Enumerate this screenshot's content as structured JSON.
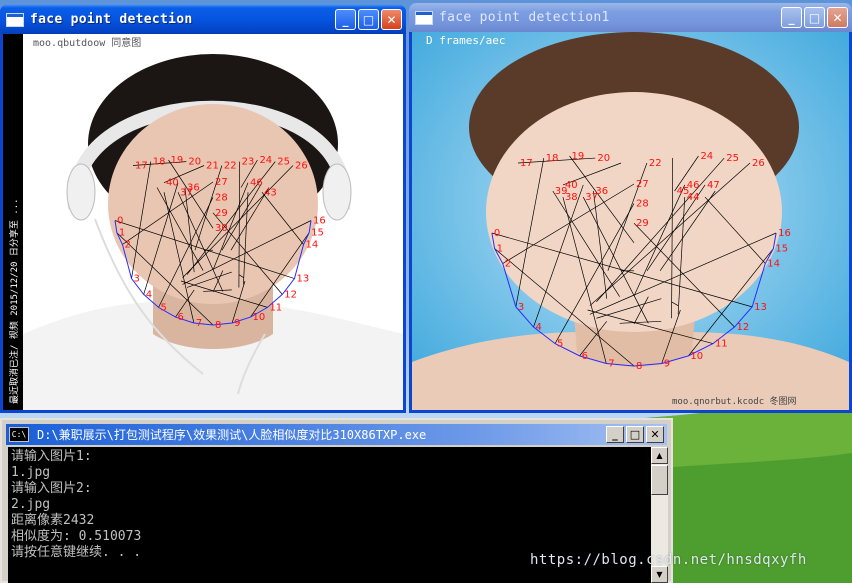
{
  "windows": {
    "left": {
      "title": "face point detection",
      "overlay_top": "moo.qbutdoow 同意图",
      "overlay_side": "最近取消已注/ 视频 2015/12/20 日分享至 ..."
    },
    "right": {
      "title": "face point detection1",
      "overlay_top": "D frames/aec",
      "overlay_bottom": "moo.qnorbut.kcodc 冬图网"
    }
  },
  "title_buttons": {
    "minimize": "_",
    "maximize": "□",
    "close": "✕"
  },
  "landmark_labels_left": [
    "0",
    "1",
    "2",
    "3",
    "4",
    "5",
    "6",
    "7",
    "8",
    "9",
    "10",
    "11",
    "12",
    "13",
    "14",
    "15",
    "16",
    "17",
    "18",
    "19",
    "20",
    "21",
    "22",
    "23",
    "24",
    "25",
    "26",
    "27",
    "28",
    "29",
    "30",
    "36",
    "37",
    "40",
    "43",
    "46"
  ],
  "landmark_labels_right": [
    "0",
    "1",
    "2",
    "3",
    "4",
    "5",
    "6",
    "7",
    "8",
    "9",
    "10",
    "11",
    "12",
    "13",
    "14",
    "15",
    "16",
    "17",
    "18",
    "19",
    "20",
    "22",
    "24",
    "25",
    "26",
    "27",
    "28",
    "29",
    "36",
    "37",
    "38",
    "39",
    "40",
    "44",
    "45",
    "46",
    "47"
  ],
  "console": {
    "title": "D:\\兼职展示\\打包测试程序\\效果测试\\人脸相似度对比310X86TXP.exe",
    "icon_label": "C:\\",
    "lines": [
      "请输入图片1:",
      "1.jpg",
      "请输入图片2:",
      "2.jpg",
      "距离像素2432",
      "相似度为: 0.510073",
      "请按任意键继续. . ."
    ]
  },
  "watermark": "https://blog.csdn.net/hnsdqxyfh",
  "colors": {
    "xp_blue": "#0a5ee8",
    "landmark_red": "#ff1010",
    "jaw_blue": "#2a2aff",
    "console_bg": "#000000",
    "console_text": "#c0c0c0"
  }
}
